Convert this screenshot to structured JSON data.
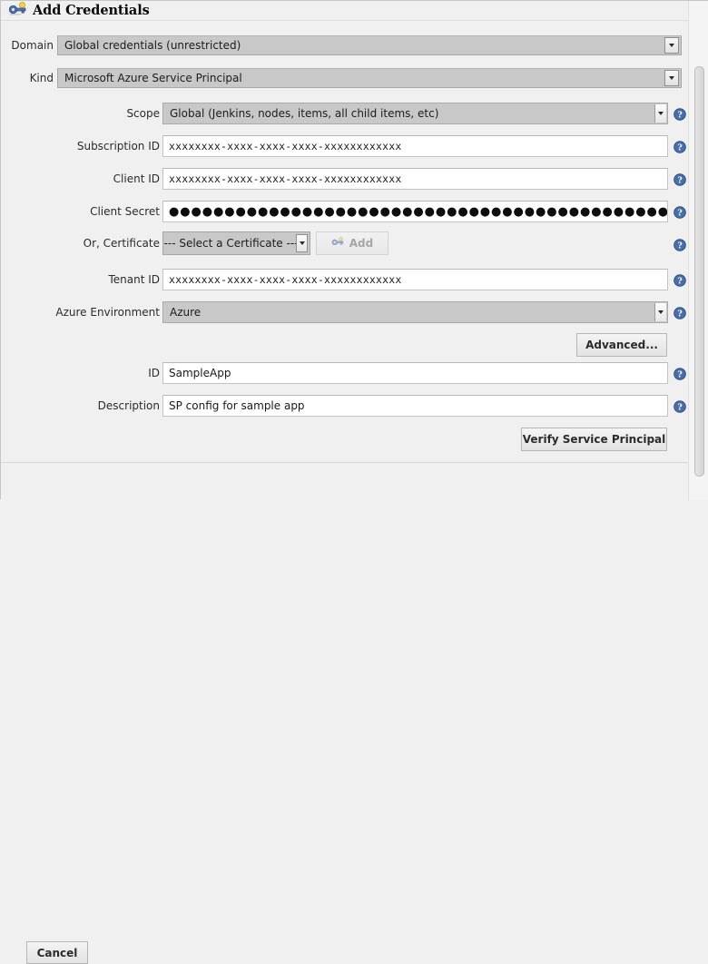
{
  "window": {
    "title": "Add Credentials",
    "title_icon": "key-icon"
  },
  "top_fields": [
    {
      "label": "Domain",
      "value": "Global credentials (unrestricted)",
      "control": "combobox",
      "name": "domain"
    },
    {
      "label": "Kind",
      "value": "Microsoft Azure Service Principal",
      "control": "combobox",
      "name": "kind"
    }
  ],
  "form_fields": [
    {
      "label": "Scope",
      "value": "Global (Jenkins, nodes, items, all child items, etc)",
      "control": "select",
      "name": "scope",
      "help": true
    },
    {
      "label": "Subscription ID",
      "value": "xxxxxxxx-xxxx-xxxx-xxxx-xxxxxxxxxxxx",
      "control": "text",
      "name": "subscription-id",
      "help": true
    },
    {
      "label": "Client ID",
      "value": "xxxxxxxx-xxxx-xxxx-xxxx-xxxxxxxxxxxx",
      "control": "text",
      "name": "client-id",
      "help": true
    },
    {
      "label": "Client Secret",
      "value": "●●●●●●●●●●●●●●●●●●●●●●●●●●●●●●●●●●●●●●●●●●●●●●●●●●●●●●",
      "control": "password",
      "name": "client-secret",
      "help": true
    },
    {
      "label": "Or, Certificate",
      "value": "--- Select a Certificate ---",
      "control": "select-small",
      "name": "certificate",
      "help": true,
      "button": {
        "label": "Add",
        "icon": "key-icon",
        "disabled": true
      }
    },
    {
      "label": "Tenant ID",
      "value": "xxxxxxxx-xxxx-xxxx-xxxx-xxxxxxxxxxxx",
      "control": "text",
      "name": "tenant-id",
      "help": true
    },
    {
      "label": "Azure Environment",
      "value": "Azure",
      "control": "select",
      "name": "azure-environment",
      "help": true
    },
    {
      "label": "ID",
      "value": "SampleApp",
      "control": "text-plain",
      "name": "id",
      "help": true
    },
    {
      "label": "Description",
      "value": "SP config for sample app",
      "control": "text-plain",
      "name": "description",
      "help": true
    }
  ],
  "buttons": {
    "advanced": "Advanced...",
    "verify": "Verify Service Principal",
    "add": "Add",
    "cancel": "Cancel"
  },
  "colors": {
    "background": "#f0f0f0",
    "combo_fill": "#c8c8c8",
    "input_fill": "#ffffff",
    "help_blue": "#4a6fa8",
    "key_blue": "#4f6fad",
    "key_yellow": "#f3d743"
  }
}
